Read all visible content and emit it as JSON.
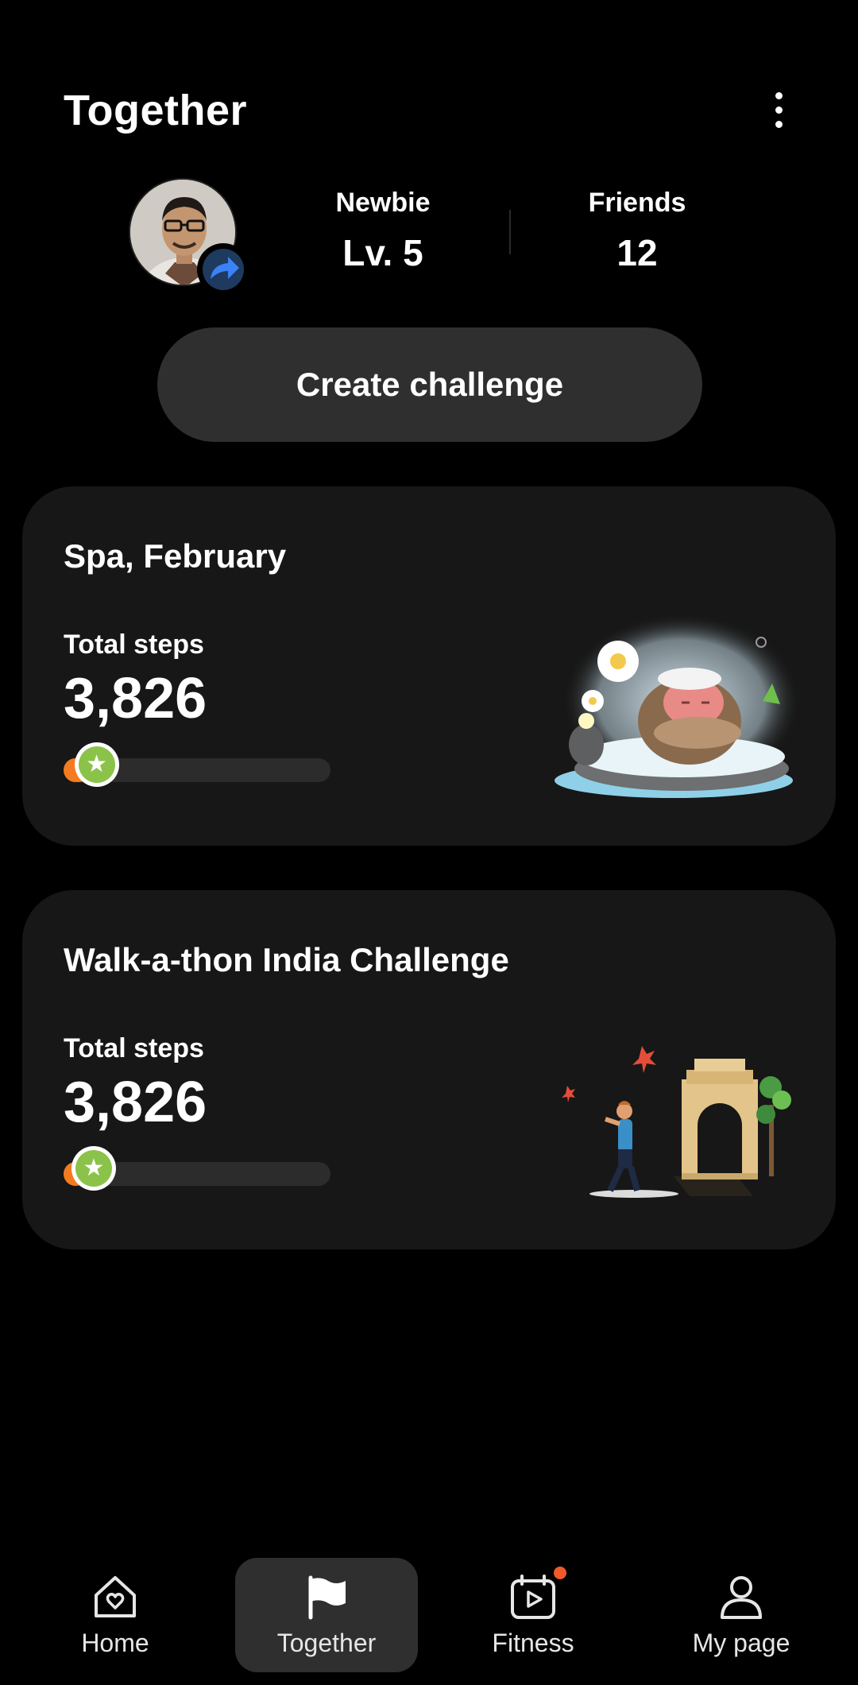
{
  "header": {
    "title": "Together"
  },
  "profile": {
    "rank_label": "Newbie",
    "level": "Lv. 5",
    "friends_label": "Friends",
    "friends_count": "12"
  },
  "create_button": "Create challenge",
  "challenges": [
    {
      "title": "Spa, February",
      "steps_label": "Total steps",
      "steps_value": "3,826",
      "progress_fraction": 0.1,
      "illustration": "monkey-hot-spring-illustration"
    },
    {
      "title": "Walk-a-thon India Challenge",
      "steps_label": "Total steps",
      "steps_value": "3,826",
      "progress_fraction": 0.06,
      "illustration": "india-gate-walker-illustration"
    }
  ],
  "nav": {
    "home": "Home",
    "together": "Together",
    "fitness": "Fitness",
    "mypage": "My page",
    "active": "together"
  },
  "colors": {
    "background": "#000000",
    "card": "#171717",
    "button": "#2f2f2f",
    "progress_fill": "#f47b20",
    "star_badge": "#8bc34a",
    "notification_dot": "#f05a28",
    "share_badge": "#3b82f6"
  }
}
